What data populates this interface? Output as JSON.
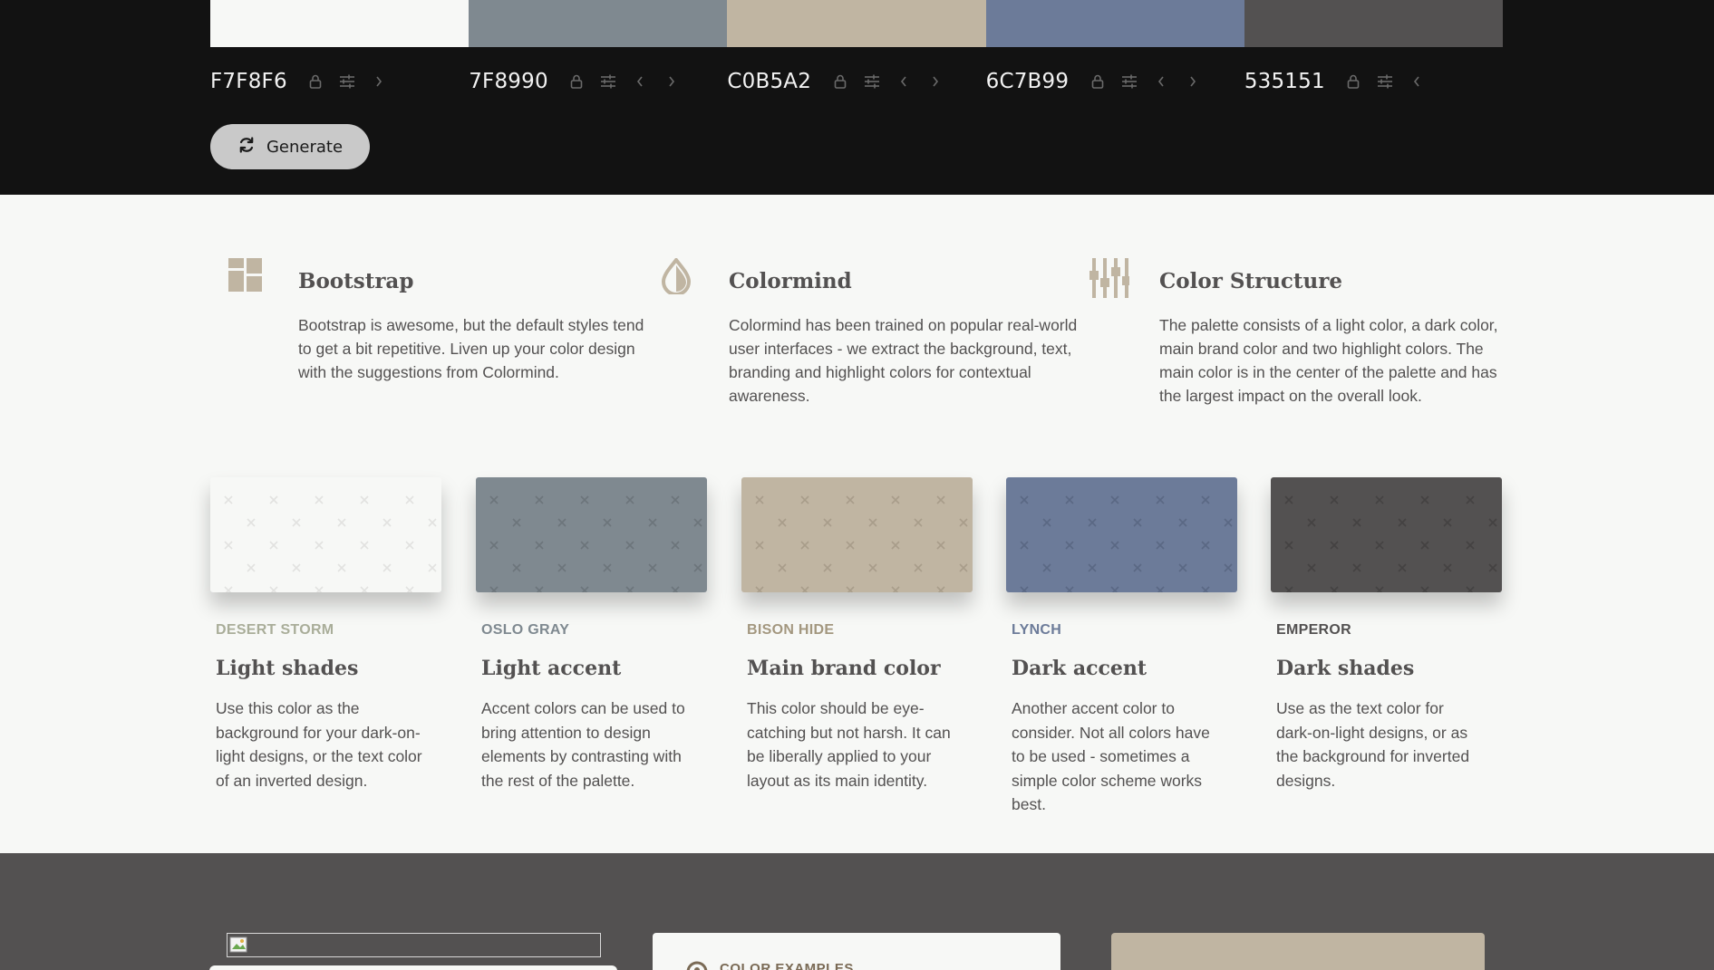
{
  "palette": [
    {
      "hex": "F7F8F6",
      "color": "#f7f8f6",
      "has_prev": false,
      "has_next": true
    },
    {
      "hex": "7F8990",
      "color": "#7f8990",
      "has_prev": true,
      "has_next": true
    },
    {
      "hex": "C0B5A2",
      "color": "#c0b5a2",
      "has_prev": true,
      "has_next": true
    },
    {
      "hex": "6C7B99",
      "color": "#6c7b99",
      "has_prev": true,
      "has_next": true
    },
    {
      "hex": "535151",
      "color": "#535151",
      "has_prev": true,
      "has_next": false
    }
  ],
  "toolbar": {
    "generate_label": "Generate"
  },
  "features": [
    {
      "icon": "grid-layout-icon",
      "title": "Bootstrap",
      "body": "Bootstrap is awesome, but the default styles tend to get a bit repetitive. Liven up your color design with the suggestions from Colormind."
    },
    {
      "icon": "drop-icon",
      "title": "Colormind",
      "body": "Colormind has been trained on popular real-world user interfaces - we extract the background, text, branding and highlight colors for contextual awareness."
    },
    {
      "icon": "sliders-icon",
      "title": "Color Structure",
      "body": "The palette consists of a light color, a dark color, main brand color and two highlight colors. The main color is in the center of the palette and has the largest impact on the overall look."
    }
  ],
  "cards": [
    {
      "color": "#f7f8f6",
      "pattern": "#e2e2e0",
      "name_color": "#a9ad99",
      "name": "DESERT STORM",
      "title": "Light shades",
      "body": "Use this color as the background for your dark-on-light designs, or the text color of an inverted design."
    },
    {
      "color": "#7f8990",
      "pattern": "#6c757b",
      "name_color": "#7f8990",
      "name": "OSLO GRAY",
      "title": "Light accent",
      "body": "Accent colors can be used to bring attention to design elements by contrasting with the rest of the palette."
    },
    {
      "color": "#c0b5a2",
      "pattern": "#a89d8a",
      "name_color": "#a3977f",
      "name": "BISON HIDE",
      "title": "Main brand color",
      "body": "This color should be eye-catching but not harsh. It can be liberally applied to your layout as its main identity."
    },
    {
      "color": "#6c7b99",
      "pattern": "#5a6884",
      "name_color": "#6c7b99",
      "name": "LYNCH",
      "title": "Dark accent",
      "body": "Another accent color to consider. Not all colors have to be used - sometimes a simple color scheme works best."
    },
    {
      "color": "#535151",
      "pattern": "#444242",
      "name_color": "#535151",
      "name": "EMPEROR",
      "title": "Dark shades",
      "body": "Use as the text color for dark-on-light designs, or as the background for inverted designs."
    }
  ],
  "examples": {
    "label": "COLOR EXAMPLES"
  },
  "colors": {
    "topbar_bg": "#121212",
    "page_bg": "#f7f8f6",
    "bottom_bg": "#535151"
  }
}
